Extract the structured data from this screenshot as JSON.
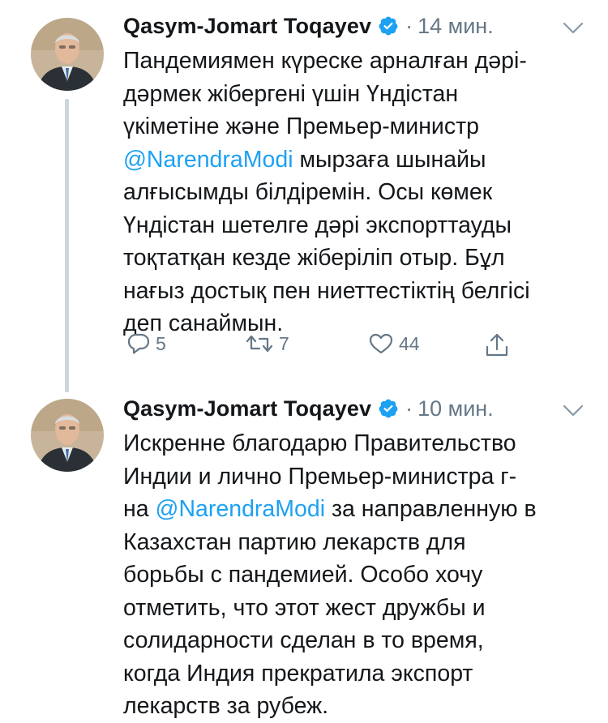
{
  "tweets": [
    {
      "author": "Qasym-Jomart Toqayev",
      "separator": "·",
      "time": "14 мин.",
      "lines": [
        {
          "pre": "Пандемиямен күреске арналған дәрі-",
          "mention": "",
          "post": ""
        },
        {
          "pre": "дәрмек жібергені үшін Үндістан",
          "mention": "",
          "post": ""
        },
        {
          "pre": "үкіметіне және Премьер-министр",
          "mention": "",
          "post": ""
        },
        {
          "pre": "",
          "mention": "@NarendraModi",
          "post": " мырзаға шынайы"
        },
        {
          "pre": "алғысымды білдіремін. Осы көмек",
          "mention": "",
          "post": ""
        },
        {
          "pre": "Үндістан шетелге дәрі экспорттауды",
          "mention": "",
          "post": ""
        },
        {
          "pre": "тоқтатқан кезде жіберіліп отыр. Бұл",
          "mention": "",
          "post": ""
        },
        {
          "pre": "нағыз достық пен ниеттестіктің белгісі",
          "mention": "",
          "post": ""
        },
        {
          "pre": "деп санаймын.",
          "mention": "",
          "post": ""
        }
      ],
      "stats": {
        "replies": "5",
        "retweets": "7",
        "likes": "44"
      }
    },
    {
      "author": "Qasym-Jomart Toqayev",
      "separator": "·",
      "time": "10 мин.",
      "lines": [
        {
          "pre": "Искренне благодарю Правительство",
          "mention": "",
          "post": ""
        },
        {
          "pre": "Индии и лично Премьер-министра г-",
          "mention": "",
          "post": ""
        },
        {
          "pre": "на ",
          "mention": "@NarendraModi",
          "post": " за направленную в"
        },
        {
          "pre": "Казахстан партию лекарств для",
          "mention": "",
          "post": ""
        },
        {
          "pre": "борьбы с пандемией. Особо хочу",
          "mention": "",
          "post": ""
        },
        {
          "pre": "отметить, что этот жест дружбы и",
          "mention": "",
          "post": ""
        },
        {
          "pre": "солидарности сделан в то время,",
          "mention": "",
          "post": ""
        },
        {
          "pre": "когда Индия прекратила экспорт",
          "mention": "",
          "post": ""
        },
        {
          "pre": "лекарств за рубеж.",
          "mention": "",
          "post": ""
        }
      ]
    }
  ],
  "icons": {
    "verified": "verified-badge-icon",
    "menu": "chevron-down-icon",
    "reply": "reply-icon",
    "retweet": "retweet-icon",
    "like": "heart-icon",
    "share": "share-icon"
  },
  "colors": {
    "text": "#14171a",
    "secondary": "#657786",
    "link": "#1da1f2",
    "verified": "#1da1f2",
    "thread_line": "#ccd6dd"
  }
}
